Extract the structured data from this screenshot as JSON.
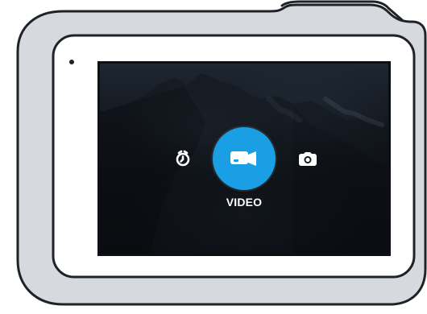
{
  "screen": {
    "selected_mode_label": "VIDEO"
  },
  "icons": {
    "left_mode": "timelapse-icon",
    "center_mode": "video-camera-icon",
    "right_mode": "photo-camera-icon"
  },
  "colors": {
    "accent": "#1A9FE5",
    "bezel": "#D6DADF",
    "outline": "#1F2328",
    "screen": "#0C0F14"
  }
}
